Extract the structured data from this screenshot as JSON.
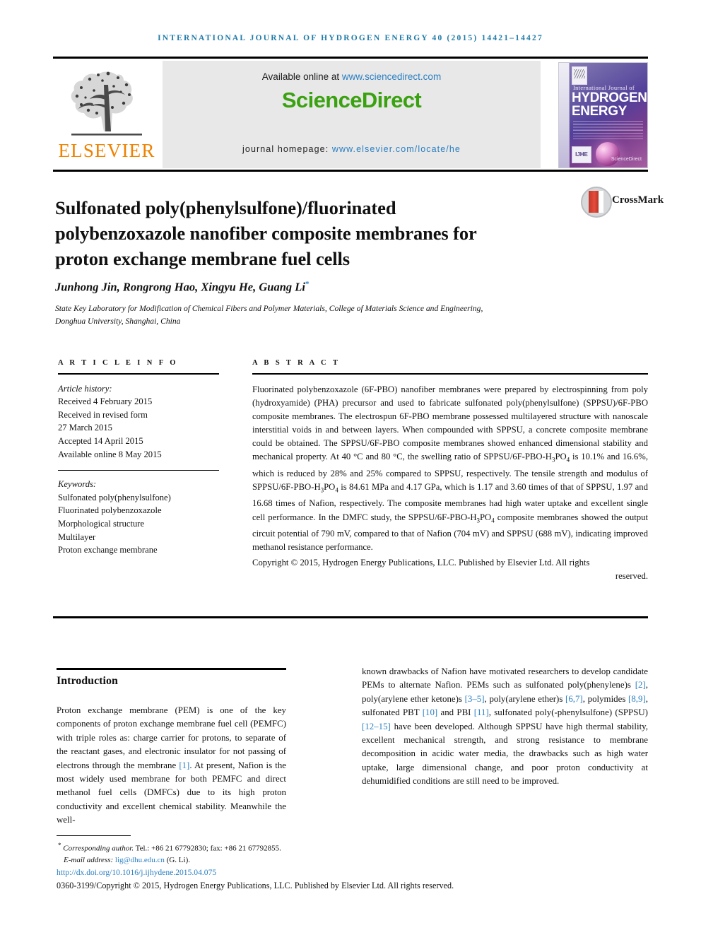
{
  "running_head": "INTERNATIONAL JOURNAL OF HYDROGEN ENERGY 40 (2015) 14421–14427",
  "masthead": {
    "publisher_name": "ELSEVIER",
    "available_prefix": "Available online at ",
    "available_url": "www.sciencedirect.com",
    "sciencedirect_logo": "ScienceDirect",
    "homepage_label": "journal homepage: ",
    "homepage_url": "www.elsevier.com/locate/he",
    "cover": {
      "line1": "International Journal of",
      "line2": "HYDROGEN",
      "line3": "ENERGY",
      "badge": "IJHE",
      "sd_mark": "ScienceDirect"
    },
    "colors": {
      "elsevier_orange": "#ef8200",
      "sciencedirect_green": "#3aa110",
      "link_blue": "#2a7fc1",
      "running_head_blue": "#1f7aa8"
    }
  },
  "article": {
    "title": "Sulfonated poly(phenylsulfone)/fluorinated polybenzoxazole nanofiber composite membranes for proton exchange membrane fuel cells",
    "authors": "Junhong Jin, Rongrong Hao, Xingyu He, Guang Li",
    "corresponding_marker": "*",
    "affiliation": "State Key Laboratory for Modification of Chemical Fibers and Polymer Materials, College of Materials Science and Engineering, Donghua University, Shanghai, China",
    "crossmark_label": "CrossMark"
  },
  "article_info": {
    "heading": "A R T I C L E   I N F O",
    "history_label": "Article history:",
    "history": [
      "Received 4 February 2015",
      "Received in revised form",
      "27 March 2015",
      "Accepted 14 April 2015",
      "Available online 8 May 2015"
    ],
    "keywords_label": "Keywords:",
    "keywords": [
      "Sulfonated poly(phenylsulfone)",
      "Fluorinated polybenzoxazole",
      "Morphological structure",
      "Multilayer",
      "Proton exchange membrane"
    ]
  },
  "abstract": {
    "heading": "A B S T R A C T",
    "paragraph_part1": "Fluorinated polybenzoxazole (6F-PBO) nanofiber membranes were prepared by electrospinning from poly (hydroxyamide) (PHA) precursor and used to fabricate sulfonated poly(phenylsulfone) (SPPSU)/6F-PBO composite membranes. The electrospun 6F-PBO membrane possessed multilayered structure with nanoscale interstitial voids in and between layers. When compounded with SPPSU, a concrete composite membrane could be obtained. The SPPSU/6F-PBO composite membranes showed enhanced dimensional stability and mechanical property. At 40 °C and 80 °C, the swelling ratio of SPPSU/6F-PBO-H",
    "sub1": "3",
    "paragraph_part2": "PO",
    "sub2": "4",
    "paragraph_part3": " is 10.1% and 16.6%, which is reduced by 28% and 25% compared to SPPSU, respectively. The tensile strength and modulus of SPPSU/6F-PBO-H",
    "sub3": "3",
    "paragraph_part4": "PO",
    "sub4": "4",
    "paragraph_part5": " is 84.61 MPa and 4.17 GPa, which is 1.17 and 3.60 times of that of SPPSU, 1.97 and 16.68 times of Nafion, respectively. The composite membranes had high water uptake and excellent single cell performance. In the DMFC study, the SPPSU/6F-PBO-H",
    "sub5": "3",
    "paragraph_part6": "PO",
    "sub6": "4",
    "paragraph_part7": " composite membranes showed the output circuit potential of 790 mV, compared to that of Nafion (704 mV) and SPPSU (688 mV), indicating improved methanol resistance performance.",
    "copyright_main": "Copyright © 2015, Hydrogen Energy Publications, LLC. Published by Elsevier Ltd. All rights",
    "copyright_end": "reserved."
  },
  "introduction": {
    "heading": "Introduction",
    "left_text_a": "Proton exchange membrane (PEM) is one of the key components of proton exchange membrane fuel cell (PEMFC) with triple roles as: charge carrier for protons, to separate of the reactant gases, and electronic insulator for not passing of electrons through the membrane ",
    "left_ref1": "[1]",
    "left_text_b": ". At present, Nafion is the most widely used membrane for both PEMFC and direct methanol fuel cells (DMFCs) due to its high proton conductivity and excellent chemical stability. Meanwhile the well-",
    "right_text_a": "known drawbacks of Nafion have motivated researchers to develop candidate PEMs to alternate Nafion. PEMs such as sulfonated poly(phenylene)s ",
    "right_ref2": "[2]",
    "right_text_b": ", poly(arylene ether ketone)s ",
    "right_ref3": "[3–5]",
    "right_text_c": ", poly(arylene ether)s ",
    "right_ref4": "[6,7]",
    "right_text_d": ", polymides ",
    "right_ref5": "[8,9]",
    "right_text_e": ", sulfonated PBT ",
    "right_ref6": "[10]",
    "right_text_f": " and PBI ",
    "right_ref7": "[11]",
    "right_text_g": ", sulfonated poly(-phenylsulfone) (SPPSU) ",
    "right_ref8": "[12–15]",
    "right_text_h": " have been developed. Although SPPSU have high thermal stability, excellent mechanical strength, and strong resistance to membrane decomposition in acidic water media, the drawbacks such as high water uptake, large dimensional change, and poor proton conductivity at dehumidified conditions are still need to be improved."
  },
  "footer": {
    "corresponding_star": "*",
    "corresponding_label": "Corresponding author.",
    "corresponding_contact": " Tel.: +86 21 67792830; fax: +86 21 67792855.",
    "email_label": "E-mail address: ",
    "email_address": "lig@dhu.edu.cn",
    "email_suffix": " (G. Li).",
    "doi": "http://dx.doi.org/10.1016/j.ijhydene.2015.04.075",
    "issn_line": "0360-3199/Copyright © 2015, Hydrogen Energy Publications, LLC. Published by Elsevier Ltd. All rights reserved."
  }
}
